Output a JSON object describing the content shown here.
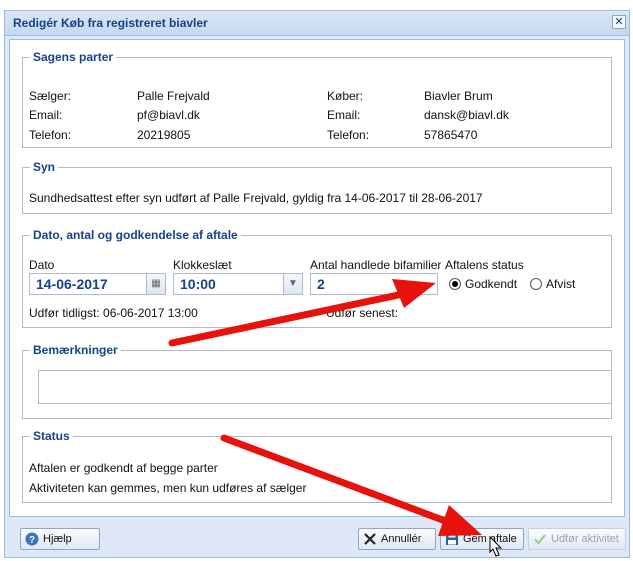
{
  "window": {
    "title": "Redigér Køb fra registreret biavler",
    "close_glyph": "✕"
  },
  "parties": {
    "legend": "Sagens parter",
    "seller": {
      "name_label": "Sælger:",
      "name": "Palle Frejvald",
      "email_label": "Email:",
      "email": "pf@biavl.dk",
      "phone_label": "Telefon:",
      "phone": "20219805"
    },
    "buyer": {
      "name_label": "Køber:",
      "name": "Biavler Brum",
      "email_label": "Email:",
      "email": "dansk@biavl.dk",
      "phone_label": "Telefon:",
      "phone": "57865470"
    }
  },
  "inspection": {
    "legend": "Syn",
    "text": "Sundhedsattest efter syn udført af Palle Frejvald, gyldig fra 14-06-2017 til 28-06-2017"
  },
  "agreement": {
    "legend": "Dato, antal og godkendelse af aftale",
    "date_label": "Dato",
    "date_value": "14-06-2017",
    "time_label": "Klokkeslæt",
    "time_value": "10:00",
    "count_label": "Antal handlede bifamilier",
    "count_value": "2",
    "status_label": "Aftalens status",
    "status_options": [
      "Godkendt",
      "Afvist"
    ],
    "status_selected": "Godkendt",
    "earliest": "Udfør tidligst: 06-06-2017 13:00",
    "latest": "Udfør senest:"
  },
  "remarks": {
    "legend": "Bemærkninger",
    "value": ""
  },
  "status": {
    "legend": "Status",
    "lines": [
      "Aftalen er godkendt af begge parter",
      "Aktiviteten kan gemmes, men kun udføres af sælger"
    ]
  },
  "buttons": {
    "help": "Hjælp",
    "cancel": "Annullér",
    "save": "Gem aftale",
    "execute": "Udfør aktivitet"
  },
  "colors": {
    "accent": "#15428b",
    "annotation": "#e8120c"
  }
}
